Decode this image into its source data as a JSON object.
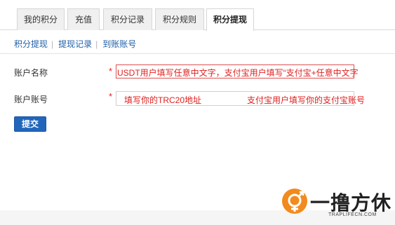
{
  "tabs": [
    {
      "label": "我的积分"
    },
    {
      "label": "充值"
    },
    {
      "label": "积分记录"
    },
    {
      "label": "积分规则"
    },
    {
      "label": "积分提现"
    }
  ],
  "subnav": [
    {
      "label": "积分提现"
    },
    {
      "label": "提现记录"
    },
    {
      "label": "到账账号"
    }
  ],
  "subnav_separator": "|",
  "form": {
    "account_name_label": "账户名称",
    "account_number_label": "账户账号",
    "required_mark": "*",
    "account_name_hint": "USDT用户填写任意中文字，支付宝用户填写“支付宝+任意中文字",
    "account_number_hint_usdt": "填写你的TRC20地址",
    "account_number_hint_alipay": "支付宝用户填写你的支付宝账号",
    "submit_label": "提交"
  },
  "watermark": {
    "text": "一撸方休",
    "sub": "TRAPLIFECN.COM"
  },
  "colors": {
    "link": "#1f5fa8",
    "hint_red": "#e02020",
    "button_blue": "#2266bb"
  }
}
